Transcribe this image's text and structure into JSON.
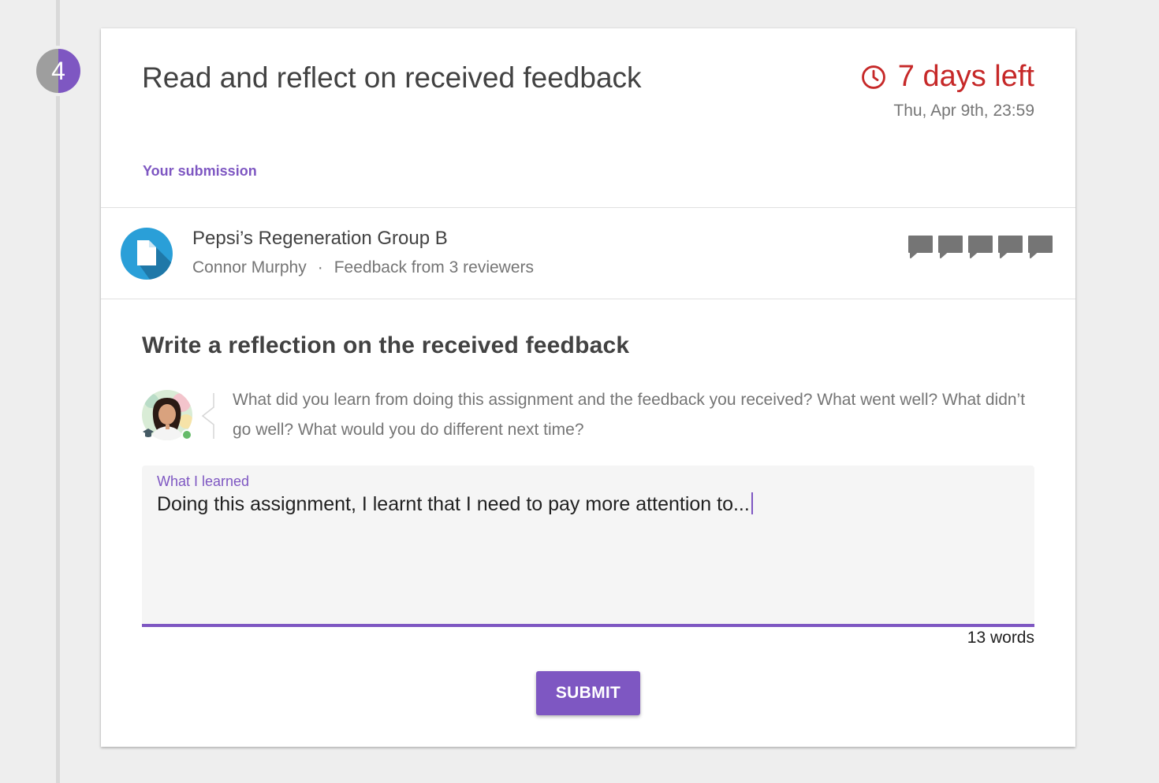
{
  "step": {
    "number": "4"
  },
  "card": {
    "title": "Read and reflect on received feedback",
    "deadline": {
      "icon": "clock-icon",
      "label": "7 days left",
      "date": "Thu, Apr 9th, 23:59"
    },
    "submission_label": "Your submission"
  },
  "submission": {
    "icon": "document-icon",
    "title": "Pepsi’s Regeneration Group B",
    "author": "Connor Murphy",
    "separator": "·",
    "feedback": "Feedback from 3 reviewers",
    "comment_icons": [
      "comment-icon",
      "comment-icon",
      "comment-icon",
      "comment-icon",
      "comment-icon"
    ]
  },
  "reflection": {
    "heading": "Write a reflection on the received feedback",
    "prompt": "What did you learn from doing this assignment and the feedback you received? What went well? What didn’t go well? What would you do different next time?",
    "field_label": "What I learned",
    "field_value": "Doing this assignment, I learnt that I need to pay more attention to...",
    "word_count": "13 words",
    "submit_label": "SUBMIT"
  },
  "colors": {
    "accent": "#7e57c2",
    "deadline": "#c62828",
    "doc_icon": "#2a9fd8"
  }
}
